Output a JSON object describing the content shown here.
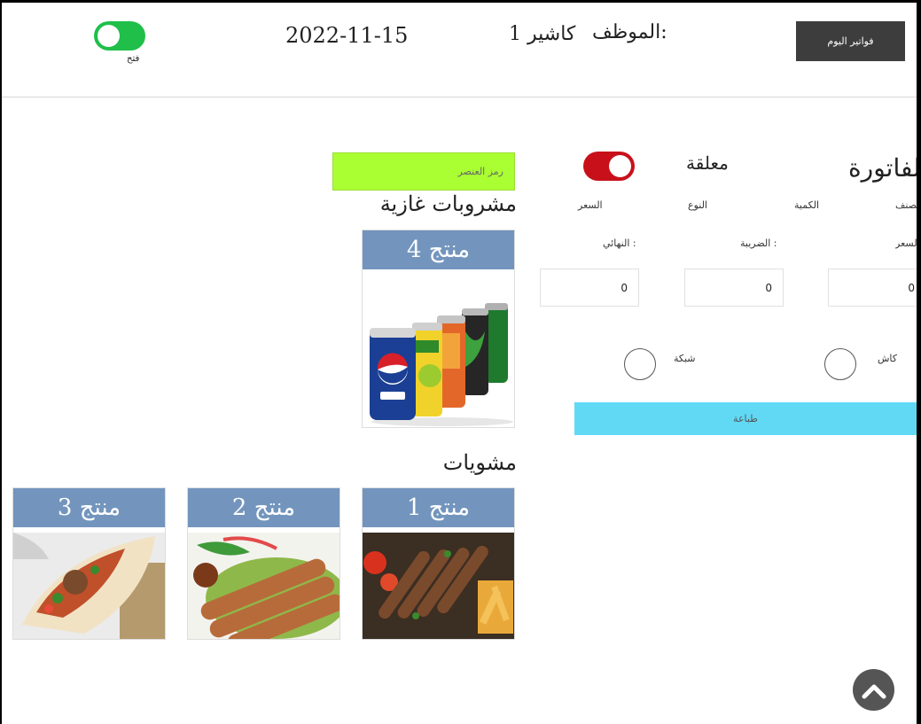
{
  "header": {
    "today_invoices_label": "فواتير اليوم",
    "employee_label": "الموظف:",
    "employee_value": "كاشير 1",
    "date": "2022-11-15",
    "open_label": "فتح",
    "open_toggle_on": true
  },
  "invoice": {
    "title": "الفاتورة",
    "hold_label": "معلقة",
    "hold_toggle_on": true,
    "columns": [
      "السعر",
      "النوع",
      "الكمية",
      "الصنف"
    ],
    "fields": {
      "final_label": "النهائي :",
      "final_value": "0",
      "tax_label": "الضريبة :",
      "tax_value": "0",
      "price_label": "السعر :",
      "price_value": "0"
    },
    "payment": {
      "network_label": "شبكة",
      "cash_label": "كاش"
    },
    "print_label": "طباعة"
  },
  "catalog": {
    "code_placeholder": "رمز العنصر",
    "categories": [
      {
        "name": "مشروبات غازية",
        "products": [
          {
            "name": "منتج 4",
            "image": "soda-cans-image"
          }
        ]
      },
      {
        "name": "مشويات",
        "products": [
          {
            "name": "منتج 1",
            "image": "kebab-platter-image"
          },
          {
            "name": "منتج 2",
            "image": "kofta-skewers-image"
          },
          {
            "name": "منتج 3",
            "image": "shawarma-wrap-image"
          }
        ]
      }
    ]
  },
  "colors": {
    "toggle_on": "#1fbf4a",
    "toggle_hold": "#c8101b",
    "card_header": "#7395bd",
    "code_input": "#aaff33",
    "print_button": "#61d9f5",
    "dark_button": "#3d3d3d"
  },
  "scroll_top_icon": "chevron-up-icon"
}
